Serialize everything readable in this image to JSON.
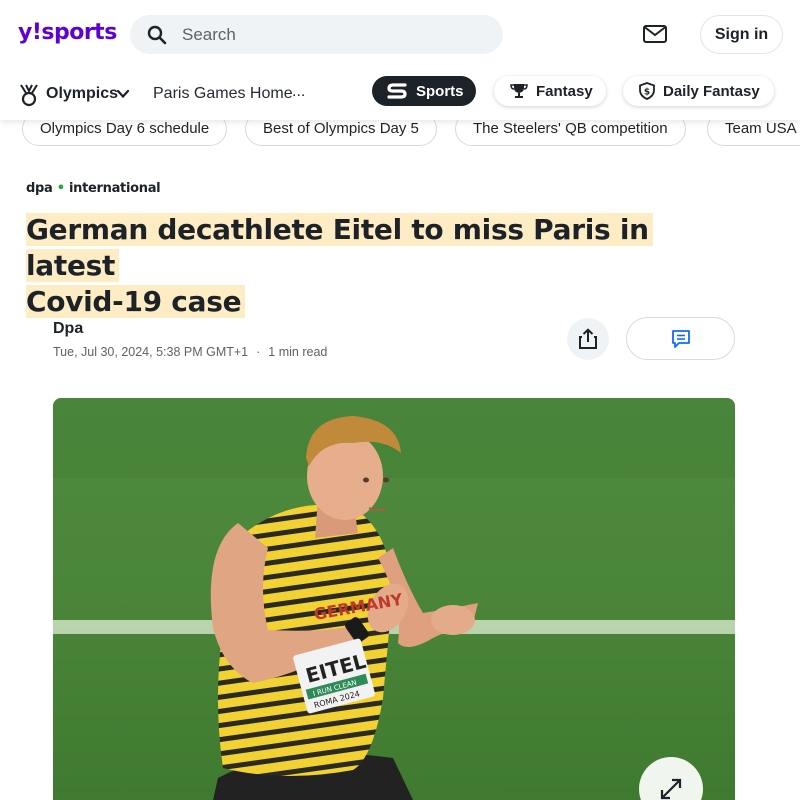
{
  "header": {
    "logo_mark": "y!",
    "logo_text": "sports",
    "search": {
      "placeholder": "Search",
      "value": ""
    },
    "mail_icon": "envelope-icon",
    "sign_in_label": "Sign in"
  },
  "subnav": {
    "section_label": "Olympics",
    "section_icon": "olympic-medal-icon",
    "home_link": "Paris Games Home",
    "more_label": "...",
    "pills": [
      {
        "label": "Sports",
        "icon": "sports-s-logo-icon"
      },
      {
        "label": "Fantasy",
        "icon": "trophy-icon"
      },
      {
        "label": "Daily Fantasy",
        "icon": "shield-dollar-icon"
      }
    ]
  },
  "trending": [
    "Olympics Day 6 schedule",
    "Best of Olympics Day 5",
    "The Steelers' QB competition",
    "Team USA r"
  ],
  "article": {
    "source_name": "dpa",
    "source_suffix": "international",
    "headline_line1": "German decathlete Eitel to miss Paris in latest",
    "headline_line2": "Covid-19 case",
    "author": "Dpa",
    "published": "Tue, Jul 30, 2024, 5:38 PM GMT+1",
    "separator": "·",
    "read_time": "1 min read",
    "share_icon": "share-upload-icon",
    "comments_icon": "comment-bubble-icon",
    "image": {
      "bib_name": "EITEL",
      "bib_sub1": "I RUN CLEAN",
      "bib_sub2": "ROMA 2024",
      "jersey_text": "GERMANY"
    },
    "expand_icon": "expand-arrows-icon"
  },
  "colors": {
    "brand": "#6001d2",
    "headline_highlight": "#fdecc4",
    "dark_pill": "#1d2228",
    "search_bg": "#f0f3f5",
    "track_green": "#4d8a3c",
    "jersey_yellow": "#f2d233"
  }
}
